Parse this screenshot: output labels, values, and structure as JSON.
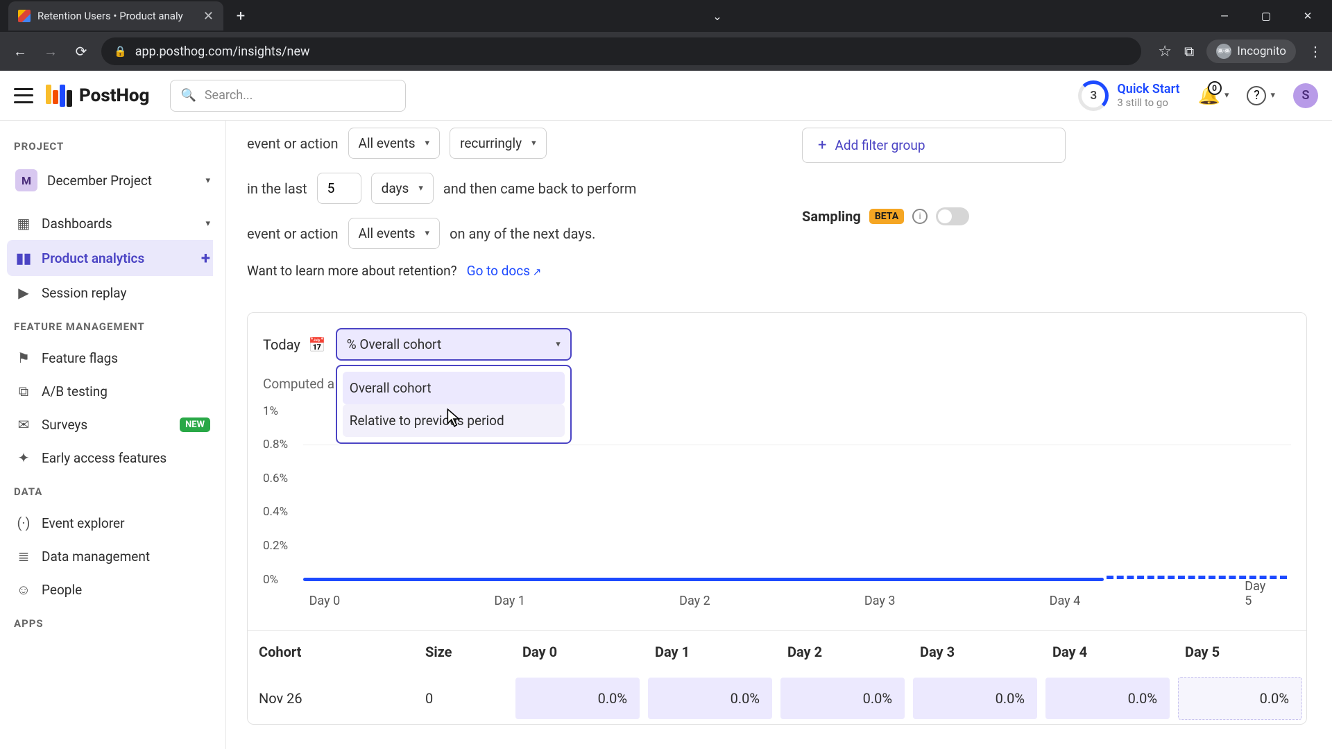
{
  "browser": {
    "tab_title": "Retention Users • Product analy",
    "url": "app.posthog.com/insights/new",
    "incognito": "Incognito"
  },
  "header": {
    "logo": "PostHog",
    "search_placeholder": "Search...",
    "quick_start_count": "3",
    "quick_start_title": "Quick Start",
    "quick_start_sub": "3 still to go",
    "notif_count": "0",
    "avatar_letter": "S"
  },
  "sidebar": {
    "section_project": "PROJECT",
    "project_letter": "M",
    "project_name": "December Project",
    "items_main": [
      {
        "label": "Dashboards",
        "icon": "▦"
      },
      {
        "label": "Product analytics",
        "icon": "▮▮"
      },
      {
        "label": "Session replay",
        "icon": "▶"
      }
    ],
    "section_feature": "FEATURE MANAGEMENT",
    "items_feature": [
      {
        "label": "Feature flags",
        "icon": "⚑"
      },
      {
        "label": "A/B testing",
        "icon": "⧉"
      },
      {
        "label": "Surveys",
        "icon": "✉",
        "badge": "NEW"
      },
      {
        "label": "Early access features",
        "icon": "✦"
      }
    ],
    "section_data": "DATA",
    "items_data": [
      {
        "label": "Event explorer",
        "icon": "(·)"
      },
      {
        "label": "Data management",
        "icon": "≣"
      },
      {
        "label": "People",
        "icon": "☺"
      }
    ],
    "section_apps": "APPS"
  },
  "config": {
    "label_event": "event or action",
    "all_events": "All events",
    "recurringly": "recurringly",
    "label_inlast": "in the last",
    "num_value": "5",
    "days": "days",
    "came_back": "and then came back to perform",
    "on_any": "on any of the next days.",
    "learn_more_pre": "Want to learn more about retention? ",
    "learn_more_link": "Go to docs",
    "add_filter": "Add filter group",
    "sampling": "Sampling",
    "beta": "BETA"
  },
  "card": {
    "today": "Today",
    "cohort_selected": "% Overall cohort",
    "dd_opt1": "Overall cohort",
    "dd_opt2": "Relative to previous period",
    "computed": "Computed a few"
  },
  "chart_data": {
    "type": "line",
    "x": [
      "Day 0",
      "Day 1",
      "Day 2",
      "Day 3",
      "Day 4",
      "Day 5"
    ],
    "values": [
      0,
      0,
      0,
      0,
      0,
      0
    ],
    "yticks": [
      "1%",
      "0.8%",
      "0.6%",
      "0.4%",
      "0.2%",
      "0%"
    ],
    "ylim": [
      0,
      1
    ],
    "title": "",
    "xlabel": "",
    "ylabel": ""
  },
  "table": {
    "headers": [
      "Cohort",
      "Size",
      "Day 0",
      "Day 1",
      "Day 2",
      "Day 3",
      "Day 4",
      "Day 5"
    ],
    "row": {
      "cohort": "Nov 26",
      "size": "0",
      "vals": [
        "0.0%",
        "0.0%",
        "0.0%",
        "0.0%",
        "0.0%",
        "0.0%"
      ]
    }
  }
}
